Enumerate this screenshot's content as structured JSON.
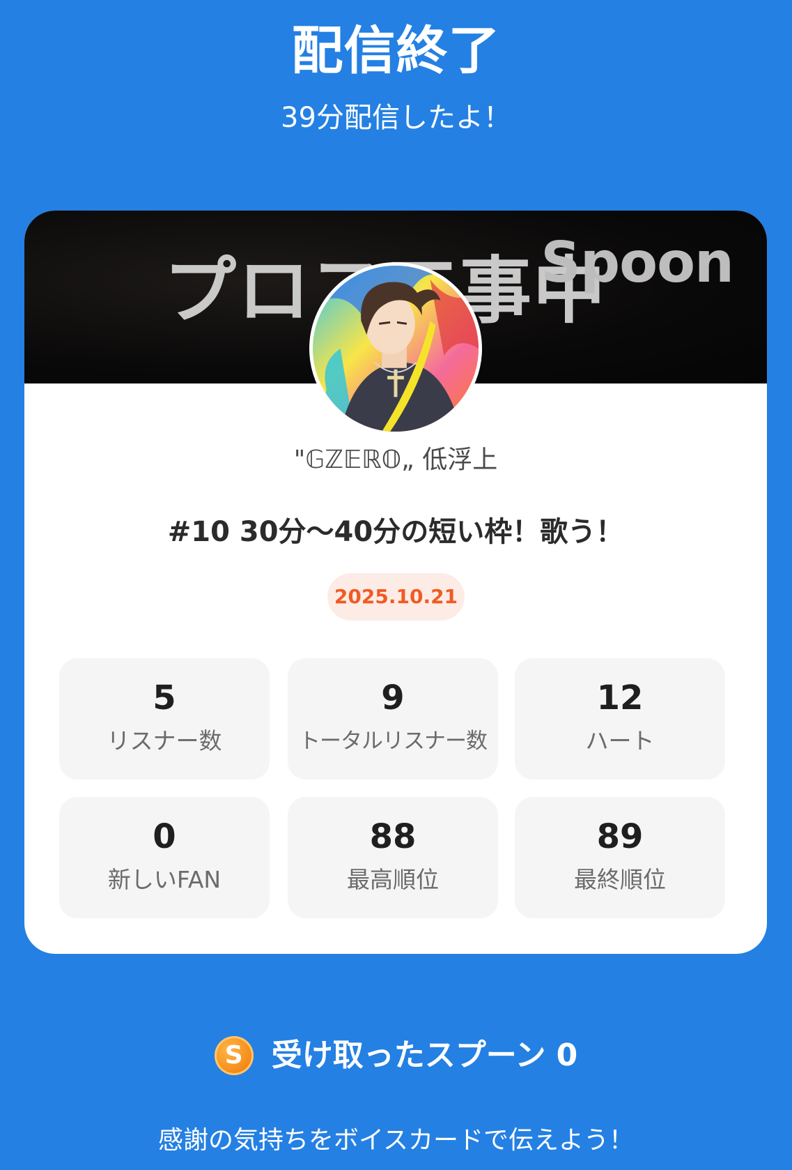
{
  "header": {
    "title": "配信終了",
    "subtitle": "39分配信したよ！"
  },
  "card": {
    "banner": {
      "text": "プロフ工事中",
      "logo": "Spoon"
    },
    "username": "\"𝔾ℤ𝔼ℝ𝕆„ 低浮上",
    "broadcast_title": "#10 30分〜40分の短い枠！歌う！",
    "date": "2025.10.21",
    "stats": [
      {
        "value": "5",
        "label": "リスナー数"
      },
      {
        "value": "9",
        "label": "トータルリスナー数"
      },
      {
        "value": "12",
        "label": "ハート"
      },
      {
        "value": "0",
        "label": "新しいFAN"
      },
      {
        "value": "88",
        "label": "最高順位"
      },
      {
        "value": "89",
        "label": "最終順位"
      }
    ]
  },
  "spoons": {
    "icon": "spoon-coin-icon",
    "icon_letter": "S",
    "label": "受け取ったスプーン",
    "count": "0"
  },
  "footer": {
    "text": "感謝の気持ちをボイスカードで伝えよう！"
  },
  "colors": {
    "background": "#2480e3",
    "card": "#ffffff",
    "date_text": "#f15a24",
    "date_bg": "#fdece6",
    "stat_bg": "#f5f5f5"
  }
}
